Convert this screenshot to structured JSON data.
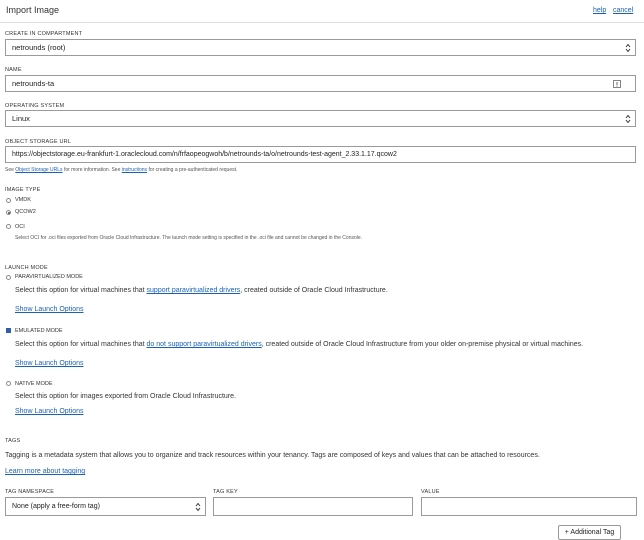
{
  "header": {
    "title": "Import Image",
    "help_label": "help",
    "cancel_label": "cancel"
  },
  "compartment": {
    "label": "CREATE IN COMPARTMENT",
    "value": "netrounds (root)"
  },
  "name": {
    "label": "NAME",
    "value": "netrounds-ta"
  },
  "os": {
    "label": "OPERATING SYSTEM",
    "value": "Linux"
  },
  "storage": {
    "label": "OBJECT STORAGE URL",
    "value": "https://objectstorage.eu-frankfurt-1.oraclecloud.com/n/frfaopeogwoh/b/netrounds-ta/o/netrounds-test-agent_2.33.1.17.qcow2",
    "help_pre": "See",
    "help_link1": "Object Storage URLs",
    "help_mid": "for more information. See",
    "help_link2": "instructions",
    "help_post": "for creating a pre-authenticated request."
  },
  "image_type": {
    "label": "IMAGE TYPE",
    "options": [
      "VMDK",
      "QCOW2",
      "OCI"
    ],
    "oci_note": "Select OCI for .oci files exported from Oracle Cloud Infrastructure. The launch mode setting is specified in the .oci file and cannot be changed in the Console."
  },
  "launch_mode": {
    "label": "LAUNCH MODE",
    "para": {
      "label": "PARAVIRTUALIZED MODE",
      "desc_pre": "Select this option for virtual machines that",
      "desc_link": "support paravirtualized drivers",
      "desc_post": ", created outside of Oracle Cloud Infrastructure.",
      "show": "Show Launch Options"
    },
    "emulated": {
      "label": "EMULATED MODE",
      "desc_pre": "Select this option for virtual machines that",
      "desc_link": "do not support paravirtualized drivers",
      "desc_post": ", created outside of Oracle Cloud Infrastructure from your older on-premise physical or virtual machines.",
      "show": "Show Launch Options"
    },
    "native": {
      "label": "NATIVE MODE",
      "desc": "Select this option for images exported from Oracle Cloud Infrastructure.",
      "show": "Show Launch Options"
    }
  },
  "tags": {
    "label": "TAGS",
    "desc": "Tagging is a metadata system that allows you to organize and track resources within your tenancy. Tags are composed of keys and values that can be attached to resources.",
    "learn_more": "Learn more about tagging",
    "namespace_label": "TAG NAMESPACE",
    "namespace_value": "None (apply a free-form tag)",
    "key_label": "TAG KEY",
    "value_label": "VALUE",
    "add_button": "+ Additional Tag"
  }
}
